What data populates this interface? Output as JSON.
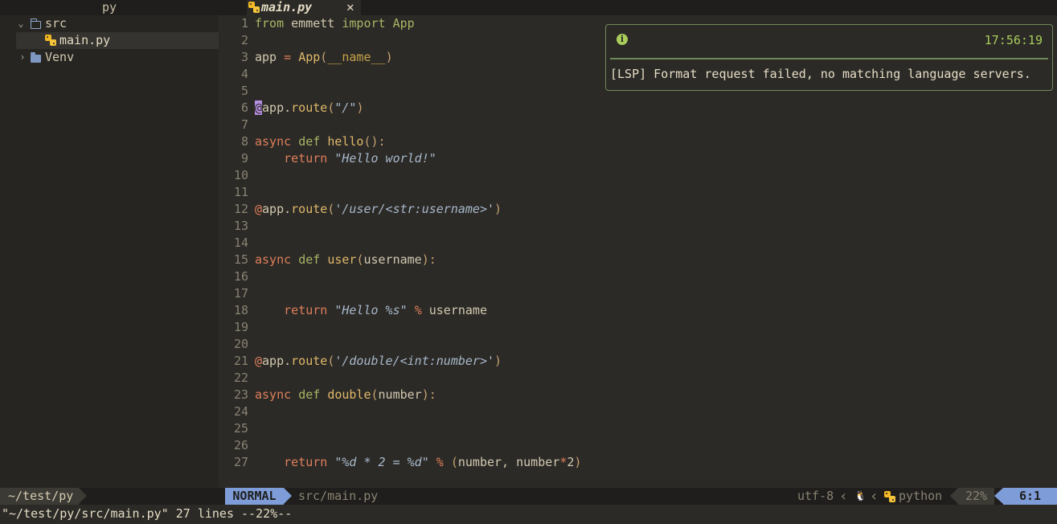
{
  "sidebar": {
    "title": "py",
    "items": [
      {
        "label": "src",
        "expanded": true,
        "icon": "folder-outline-icon"
      },
      {
        "label": "main.py",
        "icon": "python-icon",
        "selected": true
      },
      {
        "label": "Venv",
        "expanded": false,
        "icon": "folder-icon"
      }
    ]
  },
  "tab": {
    "title": "main.py",
    "close_glyph": "✕"
  },
  "editor": {
    "line_numbers": [
      "1",
      "2",
      "3",
      "4",
      "5",
      "6",
      "7",
      "8",
      "9",
      "10",
      "11",
      "12",
      "13",
      "14",
      "15",
      "16",
      "17",
      "18",
      "19",
      "20",
      "21",
      "22",
      "23",
      "24",
      "25",
      "26",
      "27"
    ],
    "lines": {
      "l1": {
        "kw1": "from",
        "mod": " emmett ",
        "kw2": "import",
        "cls": " App"
      },
      "l3": {
        "var": "app ",
        "op": "=",
        "sp": " ",
        "fn": "App",
        "p1": "(",
        "dunder": "__name__",
        "p2": ")"
      },
      "l6": {
        "at": "@",
        "rest": "app.",
        "fn": "route",
        "p1": "(",
        "str": "\"/\"",
        "p2": ")"
      },
      "l8": {
        "kw1": "async",
        "sp": " ",
        "kw2": "def",
        "sp2": " ",
        "fn": "hello",
        "p": "():"
      },
      "l9": {
        "indent": "    ",
        "kw": "return",
        "sp": " ",
        "str": "\"Hello world!\""
      },
      "l12": {
        "at": "@",
        "rest": "app.",
        "fn": "route",
        "p1": "(",
        "str": "'/user/<str:username>'",
        "p2": ")"
      },
      "l15": {
        "kw1": "async",
        "sp": " ",
        "kw2": "def",
        "sp2": " ",
        "fn": "user",
        "p1": "(",
        "arg": "username",
        "p2": "):"
      },
      "l18": {
        "indent": "    ",
        "kw": "return",
        "sp": " ",
        "str": "\"Hello %s\"",
        "sp2": " ",
        "op": "%",
        "rest": " username"
      },
      "l21": {
        "at": "@",
        "rest": "app.",
        "fn": "route",
        "p1": "(",
        "str": "'/double/<int:number>'",
        "p2": ")"
      },
      "l23": {
        "kw1": "async",
        "sp": " ",
        "kw2": "def",
        "sp2": " ",
        "fn": "double",
        "p1": "(",
        "arg": "number",
        "p2": "):"
      },
      "l27": {
        "indent": "    ",
        "kw": "return",
        "sp": " ",
        "str": "\"%d * 2 = %d\"",
        "sp2": " ",
        "op": "%",
        "sp3": " ",
        "p1": "(",
        "a": "number, number",
        "op2": "*",
        "n": "2",
        "p2": ")"
      }
    }
  },
  "notification": {
    "icon": "info-icon",
    "icon_glyph": "i",
    "time": "17:56:19",
    "message": "[LSP] Format request failed, no matching language servers."
  },
  "statusline": {
    "cwd": "~/test/py",
    "mode": "NORMAL",
    "file": "src/main.py",
    "encoding": "utf-8",
    "os_icon": "linux-icon",
    "os_glyph": "🐧",
    "language": "python",
    "percent": "22%",
    "position": "6:1"
  },
  "cmdline": {
    "text": "\"~/test/py/src/main.py\" 27 lines --22%--"
  },
  "colors": {
    "accent": "#7e9cd8",
    "notify_border": "#6f8a5a",
    "notify_text": "#a9cc5a",
    "background": "#2b2a27"
  }
}
